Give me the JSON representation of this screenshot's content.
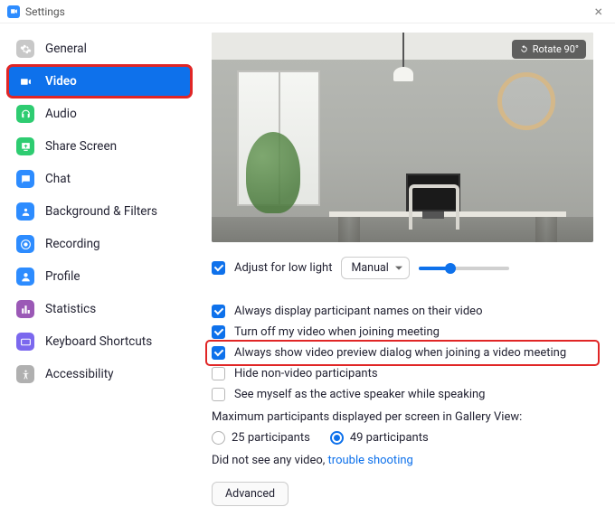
{
  "window": {
    "title": "Settings"
  },
  "sidebar": {
    "items": [
      {
        "label": "General"
      },
      {
        "label": "Video"
      },
      {
        "label": "Audio"
      },
      {
        "label": "Share Screen"
      },
      {
        "label": "Chat"
      },
      {
        "label": "Background & Filters"
      },
      {
        "label": "Recording"
      },
      {
        "label": "Profile"
      },
      {
        "label": "Statistics"
      },
      {
        "label": "Keyboard Shortcuts"
      },
      {
        "label": "Accessibility"
      }
    ]
  },
  "preview": {
    "rotate_label": "Rotate 90°"
  },
  "adjust": {
    "label": "Adjust for low light",
    "mode": "Manual",
    "slider_value": 35
  },
  "options": {
    "display_names": "Always display participant names on their video",
    "turn_off_video": "Turn off my video when joining meeting",
    "show_preview": "Always show video preview dialog when joining a video meeting",
    "hide_nonvideo": "Hide non-video participants",
    "see_myself": "See myself as the active speaker while speaking"
  },
  "gallery": {
    "label": "Maximum participants displayed per screen in Gallery View:",
    "opt25": "25 participants",
    "opt49": "49 participants"
  },
  "hint": {
    "prefix": "Did not see any video, ",
    "link": "trouble shooting"
  },
  "advanced_label": "Advanced"
}
